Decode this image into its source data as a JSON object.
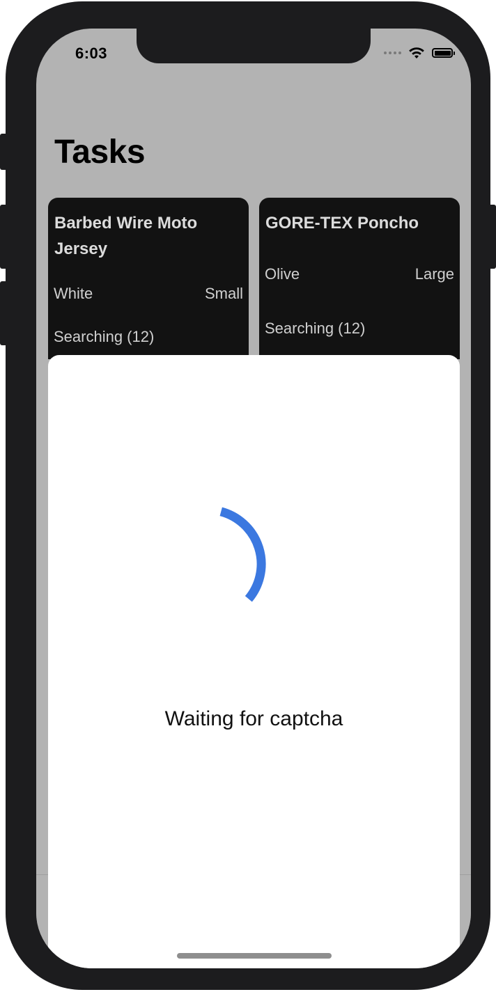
{
  "status_bar": {
    "time": "6:03",
    "icons": [
      "cellular-signal-icon",
      "wifi-icon",
      "battery-icon"
    ]
  },
  "header": {
    "title": "Tasks"
  },
  "tasks": [
    {
      "name": "Barbed Wire Moto Jersey",
      "color": "White",
      "size": "Small",
      "status": "Searching (12)"
    },
    {
      "name": "GORE-TEX Poncho",
      "color": "Olive",
      "size": "Large",
      "status": "Searching (12)"
    }
  ],
  "modal": {
    "message": "Waiting for captcha",
    "spinner_color": "#3b78e0"
  },
  "colors": {
    "screen_background": "#b3b3b3",
    "card_background": "#121212",
    "device_frame": "#1c1c1e"
  }
}
